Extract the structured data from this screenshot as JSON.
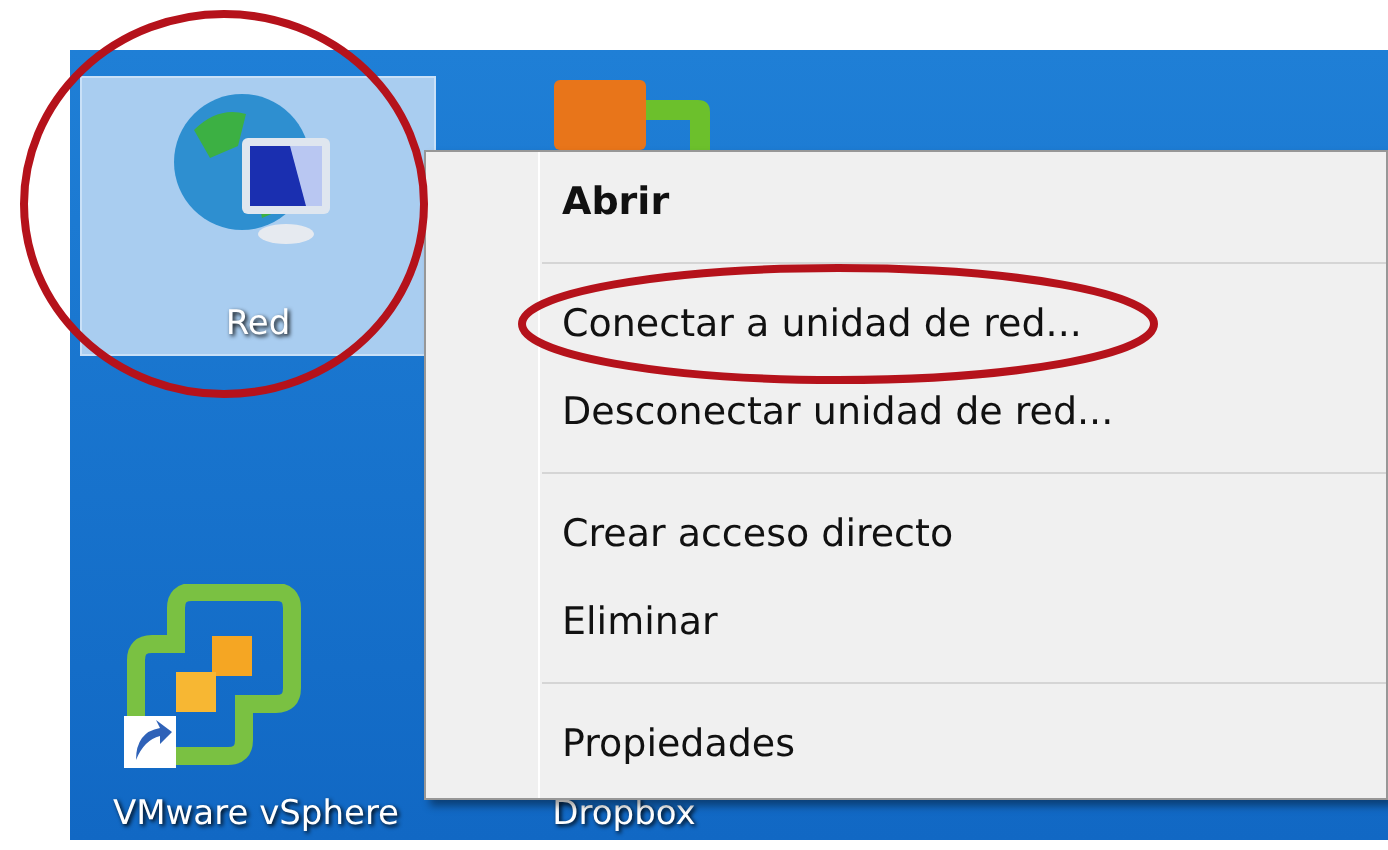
{
  "desktop": {
    "icons": [
      {
        "label": "Red",
        "kind": "network",
        "selected": true,
        "circled": true
      },
      {
        "kind": "folder",
        "selected": false,
        "circled": false
      },
      {
        "label": "VMware vSphere",
        "kind": "vsphere",
        "selected": false,
        "circled": false
      },
      {
        "label": "Dropbox",
        "kind": "hidden",
        "selected": false,
        "circled": false
      }
    ]
  },
  "context_menu": {
    "groups": [
      [
        {
          "label": "Abrir",
          "default": true,
          "circled": false
        }
      ],
      [
        {
          "label": "Conectar a unidad de red...",
          "default": false,
          "circled": true
        },
        {
          "label": "Desconectar unidad de red...",
          "default": false,
          "circled": false
        }
      ],
      [
        {
          "label": "Crear acceso directo",
          "default": false,
          "circled": false
        },
        {
          "label": "Eliminar",
          "default": false,
          "circled": false
        }
      ],
      [
        {
          "label": "Propiedades",
          "default": false,
          "circled": false
        }
      ]
    ]
  }
}
